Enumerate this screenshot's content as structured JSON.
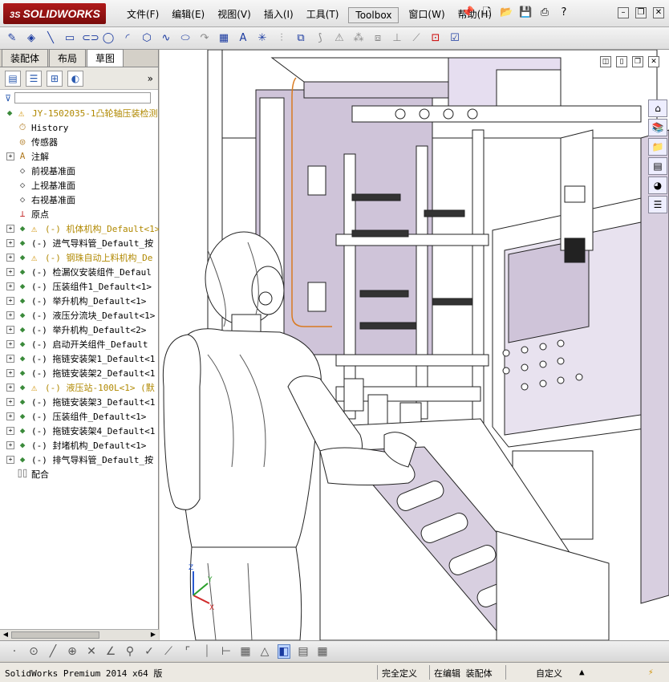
{
  "app": {
    "logo_text": "SOLIDWORKS",
    "logo_ds": "3S"
  },
  "menu": {
    "items": [
      "文件(F)",
      "编辑(E)",
      "视图(V)",
      "插入(I)",
      "工具(T)",
      "Toolbox",
      "窗口(W)",
      "帮助(H)"
    ]
  },
  "tabs": [
    "装配体",
    "布局",
    "草图"
  ],
  "tree": {
    "root": "JY-1502035-1凸轮轴压装检测",
    "items": [
      {
        "label": "History",
        "icon": "history-icon",
        "expand": false,
        "color": "normal"
      },
      {
        "label": "传感器",
        "icon": "sensor-icon",
        "expand": false,
        "color": "normal"
      },
      {
        "label": "注解",
        "icon": "annotation-icon",
        "expand": true,
        "color": "normal"
      },
      {
        "label": "前视基准面",
        "icon": "plane-icon",
        "expand": false,
        "color": "normal"
      },
      {
        "label": "上视基准面",
        "icon": "plane-icon",
        "expand": false,
        "color": "normal"
      },
      {
        "label": "右视基准面",
        "icon": "plane-icon",
        "expand": false,
        "color": "normal"
      },
      {
        "label": "原点",
        "icon": "origin-icon",
        "expand": false,
        "color": "normal"
      },
      {
        "label": "(-) 机体机构_Default<1>",
        "icon": "assembly-icon",
        "expand": true,
        "warn": true,
        "color": "yel"
      },
      {
        "label": "(-) 进气导料管_Default_按",
        "icon": "assembly-icon",
        "expand": true,
        "color": "normal"
      },
      {
        "label": "(-) 钢珠自动上料机构_De",
        "icon": "assembly-icon",
        "expand": true,
        "warn": true,
        "color": "yel"
      },
      {
        "label": "(-) 检漏仪安装组件_Defaul",
        "icon": "assembly-icon",
        "expand": true,
        "color": "normal"
      },
      {
        "label": "(-) 压装组件1_Default<1>",
        "icon": "assembly-icon",
        "expand": true,
        "color": "normal"
      },
      {
        "label": "(-) 举升机构_Default<1>",
        "icon": "assembly-icon",
        "expand": true,
        "color": "normal"
      },
      {
        "label": "(-) 液压分流块_Default<1>",
        "icon": "assembly-icon",
        "expand": true,
        "color": "normal"
      },
      {
        "label": "(-) 举升机构_Default<2>",
        "icon": "assembly-icon",
        "expand": true,
        "color": "normal"
      },
      {
        "label": "(-) 启动开关组件_Default",
        "icon": "assembly-icon",
        "expand": true,
        "color": "normal"
      },
      {
        "label": "(-) 拖链安装架1_Default<1",
        "icon": "assembly-icon",
        "expand": true,
        "color": "normal"
      },
      {
        "label": "(-) 拖链安装架2_Default<1",
        "icon": "assembly-icon",
        "expand": true,
        "color": "normal"
      },
      {
        "label": "(-) 液压站-100L<1> (默",
        "icon": "assembly-icon",
        "expand": true,
        "warn": true,
        "color": "yel"
      },
      {
        "label": "(-) 拖链安装架3_Default<1",
        "icon": "assembly-icon",
        "expand": true,
        "color": "normal"
      },
      {
        "label": "(-) 压装组件_Default<1>",
        "icon": "assembly-icon",
        "expand": true,
        "color": "normal"
      },
      {
        "label": "(-) 拖链安装架4_Default<1",
        "icon": "assembly-icon",
        "expand": true,
        "color": "normal"
      },
      {
        "label": "(-) 封堵机构_Default<1>",
        "icon": "assembly-icon",
        "expand": true,
        "color": "normal"
      },
      {
        "label": "(-) 排气导料管_Default_按",
        "icon": "assembly-icon",
        "expand": true,
        "color": "normal"
      },
      {
        "label": "配合",
        "icon": "mates-icon",
        "expand": false,
        "color": "normal"
      }
    ]
  },
  "status": {
    "product": "SolidWorks Premium 2014 x64 版",
    "definition": "完全定义",
    "editing": "在编辑 装配体",
    "units": "自定义"
  },
  "colors": {
    "part_fill": "#d8cfe0",
    "part_stroke": "#222222",
    "accent": "#1a3aa0"
  }
}
